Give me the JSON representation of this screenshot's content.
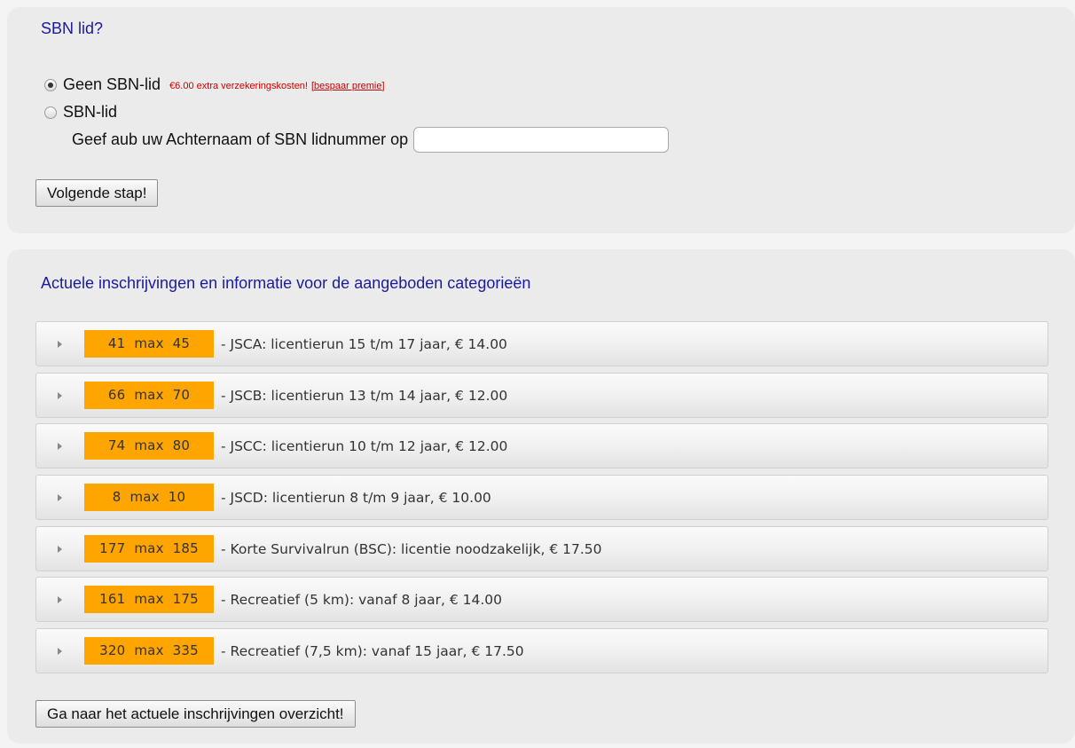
{
  "sbn": {
    "title": "SBN lid?",
    "options": [
      {
        "label": "Geen SBN-lid",
        "checked": true
      },
      {
        "label": "SBN-lid",
        "checked": false
      }
    ],
    "extra_cost": "€6.00 extra verzekeringskosten!",
    "bespaar_link": "[bespaar premie]",
    "lidnummer_label": "Geef aub uw Achternaam of SBN lidnummer op",
    "lidnummer_value": "",
    "next_button": "Volgende stap!"
  },
  "categories": {
    "title": "Actuele inschrijvingen en informatie voor de aangeboden categorieën",
    "items": [
      {
        "count": "41",
        "max_label": "max",
        "max": "45",
        "description": "- JSCA: licentierun 15 t/m 17 jaar, € 14.00"
      },
      {
        "count": "66",
        "max_label": "max",
        "max": "70",
        "description": "- JSCB: licentierun 13 t/m 14 jaar, € 12.00"
      },
      {
        "count": "74",
        "max_label": "max",
        "max": "80",
        "description": "- JSCC: licentierun 10 t/m 12 jaar, € 12.00"
      },
      {
        "count": "8",
        "max_label": "max",
        "max": "10",
        "description": "- JSCD: licentierun 8 t/m 9 jaar, € 10.00"
      },
      {
        "count": "177",
        "max_label": "max",
        "max": "185",
        "description": "- Korte Survivalrun (BSC): licentie noodzakelijk, € 17.50"
      },
      {
        "count": "161",
        "max_label": "max",
        "max": "175",
        "description": "- Recreatief (5 km): vanaf 8 jaar, € 14.00"
      },
      {
        "count": "320",
        "max_label": "max",
        "max": "335",
        "description": "- Recreatief (7,5 km): vanaf 15 jaar, € 17.50"
      }
    ],
    "overview_button": "Ga naar het actuele inschrijvingen overzicht!"
  },
  "colors": {
    "title": "#1a1aa0",
    "badge": "#ffa500",
    "warning": "#cc0000"
  },
  "icons": {
    "expand": "triangle-right-icon"
  }
}
